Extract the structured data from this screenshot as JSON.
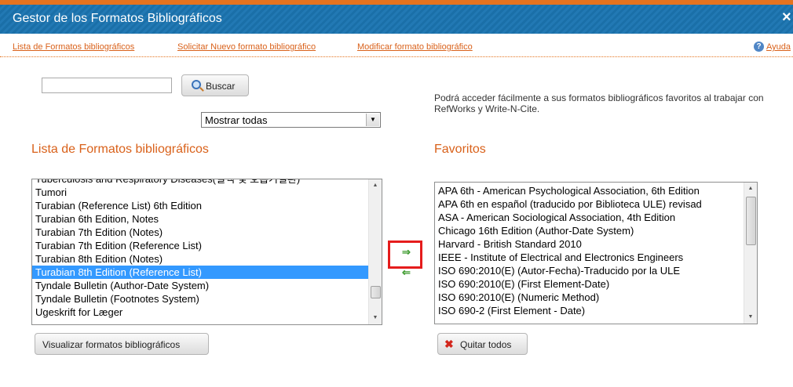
{
  "window": {
    "title": "Gestor de los Formatos Bibliográficos",
    "close_icon": "close-icon"
  },
  "nav_links": {
    "list": "Lista de Formatos bibliográficos",
    "request_new": "Solicitar Nuevo formato bibliográfico",
    "modify": "Modificar formato bibliográfico",
    "help": "Ayuda"
  },
  "search": {
    "value": "",
    "button_label": "Buscar",
    "icon": "search-icon"
  },
  "filter": {
    "selected": "Mostrar todas"
  },
  "info_text": "Podrá acceder fácilmente a sus formatos bibliográficos favoritos al trabajar con RefWorks y Write-N-Cite.",
  "left_panel": {
    "heading": "Lista de Formatos bibliográficos",
    "items": [
      "Tuberculosis and Respiratory Diseases(결핵 및 호흡기질환)",
      "Tumori",
      "Turabian (Reference List) 6th Edition",
      "Turabian 6th Edition, Notes",
      "Turabian 7th Edition (Notes)",
      "Turabian 7th Edition (Reference List)",
      "Turabian 8th Edition (Notes)",
      "Turabian 8th Edition (Reference List)",
      "Tyndale Bulletin (Author-Date System)",
      "Tyndale Bulletin (Footnotes System)",
      "Ugeskrift for Læger"
    ],
    "selected_item": "Turabian 8th Edition (Reference List)",
    "view_button": "Visualizar formatos bibliográficos"
  },
  "transfer": {
    "add_icon": "arrow-right-icon",
    "remove_icon": "arrow-left-icon",
    "add_glyph": "⇒",
    "remove_glyph": "⇐"
  },
  "right_panel": {
    "heading": "Favoritos",
    "items": [
      "APA 6th - American Psychological Association, 6th Edition",
      "APA 6th en español (traducido por Biblioteca ULE) revisad",
      "ASA - American Sociological Association, 4th Edition",
      "Chicago 16th Edition (Author-Date System)",
      "Harvard - British Standard 2010",
      "IEEE - Institute of Electrical and Electronics Engineers",
      "ISO 690:2010(E) (Autor-Fecha)-Traducido por la ULE",
      "ISO 690:2010(E) (First Element-Date)",
      "ISO 690:2010(E) (Numeric Method)",
      "ISO 690-2 (First Element - Date)"
    ],
    "clear_button": "Quitar todos",
    "clear_icon": "x-icon"
  },
  "colors": {
    "accent": "#d9611a",
    "titlebar": "#1a6fa8",
    "selection": "#3399ff",
    "highlight_box": "#e51c1c"
  }
}
